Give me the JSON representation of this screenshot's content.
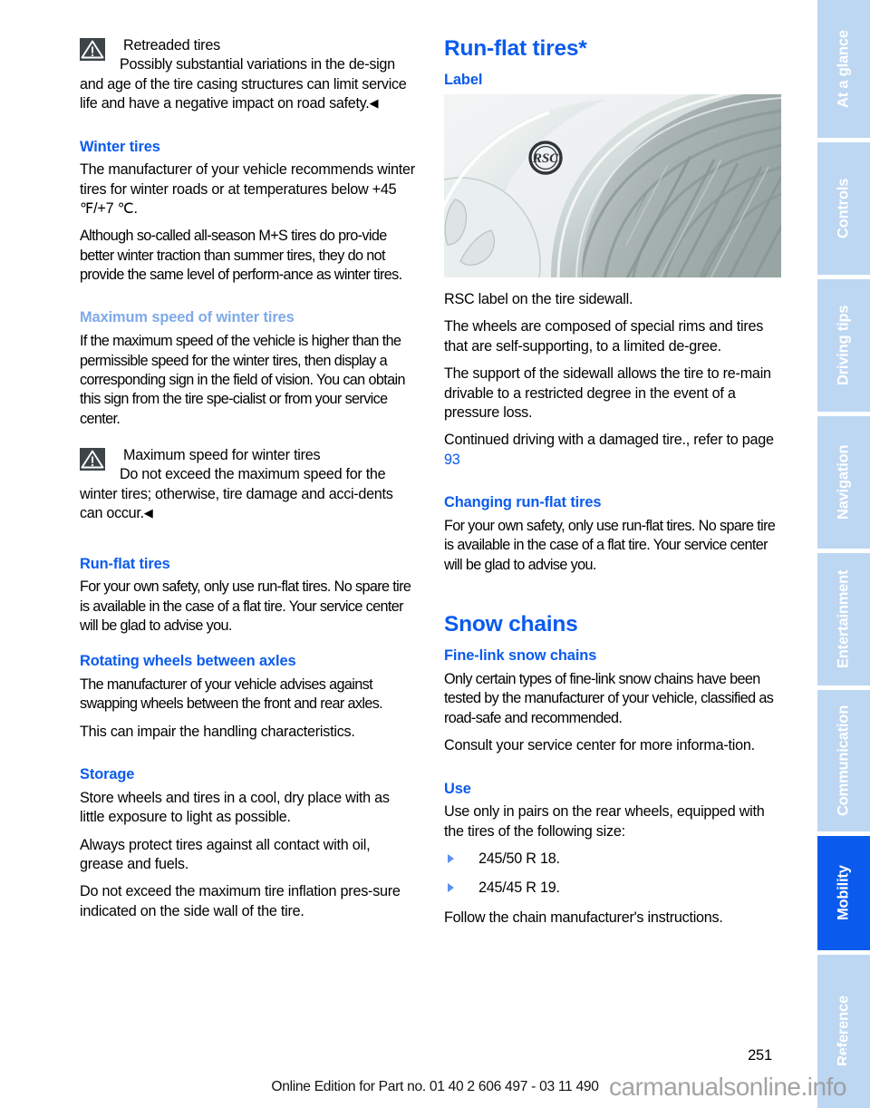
{
  "document": {
    "page_number": "251",
    "footer_note": "Online Edition for Part no. 01 40 2 606 497 - 03 11 490",
    "watermark": "carmanualsonline.info"
  },
  "colors": {
    "heading_blue": "#0a5bed",
    "subheading_light_blue": "#7fa9e8",
    "tab_inactive": "#bdd7f2",
    "tab_active": "#0a5bed",
    "warning_icon_bg": "#3d4548"
  },
  "left_column": {
    "warning_retreaded": {
      "icon": "warning-triangle-icon",
      "title": "Retreaded tires",
      "body": "Possibly substantial variations in the de-sign and age of the tire casing structures can limit service life and have a negative impact on road safety.",
      "end_mark": "◀"
    },
    "winter_tires": {
      "heading": "Winter tires",
      "paragraphs": [
        "The manufacturer of your vehicle recommends winter tires for winter roads or at temperatures below +45 ℉/+7 ℃.",
        "Although so-called all-season M+S tires do pro-vide better winter traction than summer tires, they do not provide the same level of perform-ance as winter tires."
      ]
    },
    "max_speed_winter": {
      "heading": "Maximum speed of winter tires",
      "paragraphs": [
        "If the maximum speed of the vehicle is higher than the permissible speed for the winter tires, then display a corresponding sign in the field of vision. You can obtain this sign from the tire spe-cialist or from your service center."
      ],
      "warning": {
        "icon": "warning-triangle-icon",
        "title": "Maximum speed for winter tires",
        "body": "Do not exceed the maximum speed for the winter tires; otherwise, tire damage and acci-dents can occur.",
        "end_mark": "◀"
      }
    },
    "run_flat_tires": {
      "heading": "Run-flat tires",
      "paragraphs": [
        "For your own safety, only use run-flat tires. No spare tire is available in the case of a flat tire. Your service center will be glad to advise you."
      ]
    },
    "rotating_wheels": {
      "heading": "Rotating wheels between axles",
      "paragraphs": [
        "The manufacturer of your vehicle advises against swapping wheels between the front and rear axles.",
        "This can impair the handling characteristics."
      ]
    },
    "storage": {
      "heading": "Storage",
      "paragraphs": [
        "Store wheels and tires in a cool, dry place with as little exposure to light as possible.",
        "Always protect tires against all contact with oil, grease and fuels.",
        "Do not exceed the maximum tire inflation pres-sure indicated on the side wall of the tire."
      ]
    }
  },
  "right_column": {
    "run_flat_tires": {
      "heading": "Run-flat tires*",
      "label_heading": "Label",
      "figure": {
        "name": "tire-sidewall-rsc-label-illustration",
        "marking": "RSC"
      },
      "caption": "RSC label on the tire sidewall.",
      "paragraphs": [
        "The wheels are composed of special rims and tires that are self-supporting, to a limited de-gree.",
        "The support of the sidewall allows the tire to re-main drivable to a restricted degree in the event of a pressure loss."
      ],
      "cross_reference": {
        "text_before": "Continued driving with a damaged tire., refer to page ",
        "page": "93"
      }
    },
    "changing_run_flat": {
      "heading": "Changing run-flat tires",
      "paragraphs": [
        "For your own safety, only use run-flat tires. No spare tire is available in the case of a flat tire. Your service center will be glad to advise you."
      ]
    },
    "snow_chains": {
      "heading": "Snow chains",
      "fine_link": {
        "heading": "Fine-link snow chains",
        "paragraphs": [
          "Only certain types of fine-link snow chains have been tested by the manufacturer of your vehicle, classified as road-safe and recommended.",
          "Consult your service center for more informa-tion."
        ]
      },
      "use": {
        "heading": "Use",
        "intro": "Use only in pairs on the rear wheels, equipped with the tires of the following size:",
        "sizes": [
          "245/50 R 18.",
          "245/45 R 19."
        ],
        "outro": "Follow the chain manufacturer's instructions."
      }
    }
  },
  "side_tabs": [
    {
      "label": "At a glance",
      "active": false
    },
    {
      "label": "Controls",
      "active": false
    },
    {
      "label": "Driving tips",
      "active": false
    },
    {
      "label": "Navigation",
      "active": false
    },
    {
      "label": "Entertainment",
      "active": false
    },
    {
      "label": "Communication",
      "active": false
    },
    {
      "label": "Mobility",
      "active": true
    },
    {
      "label": "Reference",
      "active": false
    }
  ]
}
